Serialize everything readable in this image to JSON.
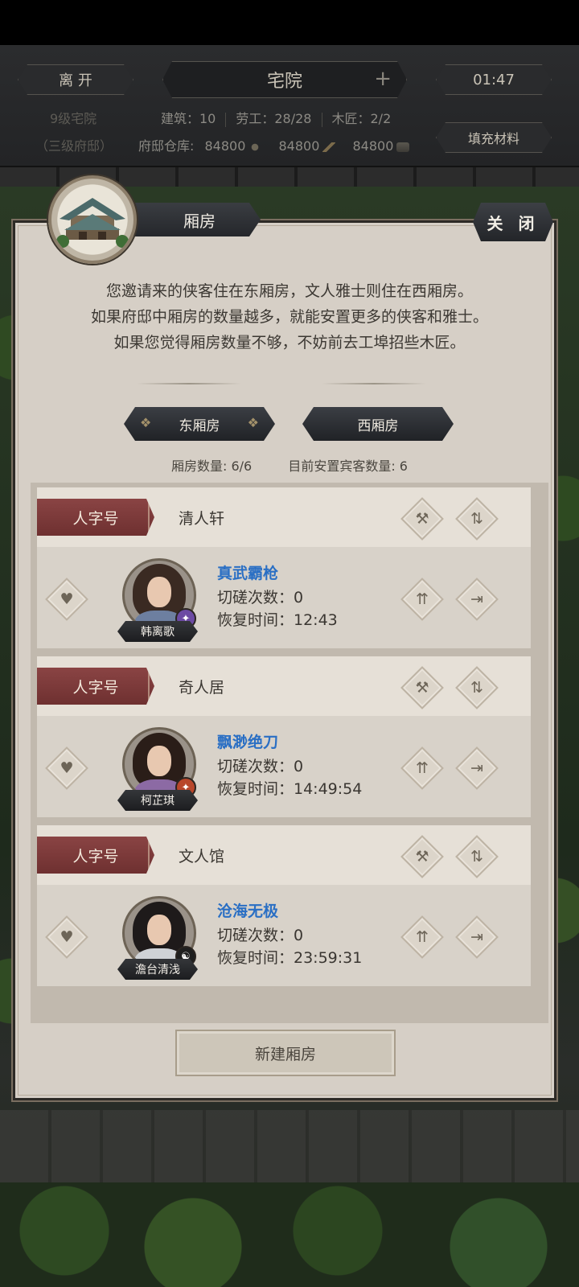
{
  "top": {
    "leave_label": "离 开",
    "title": "宅院",
    "timer": "01:47",
    "residence_level": "9级宅院",
    "residence_sub": "（三级府邸）",
    "building": "建筑：10",
    "labor": "劳工：28/28",
    "carpenter": "木匠：2/2",
    "warehouse_label": "府邸仓库:",
    "res1": "84800",
    "res2": "84800",
    "res3": "84800",
    "fill_label": "填充材料"
  },
  "panel": {
    "title": "厢房",
    "close_label": "关 闭",
    "intro": [
      "您邀请来的侠客住在东厢房，文人雅士则住在西厢房。",
      "如果府邸中厢房的数量越多，就能安置更多的侠客和雅士。",
      "如果您觉得厢房数量不够，不妨前去工埠招些木匠。"
    ],
    "tabs": [
      "东厢房",
      "西厢房"
    ],
    "room_count": "厢房数量: 6/6",
    "guest_count": "目前安置宾客数量: 6",
    "new_room_label": "新建厢房"
  },
  "rooms": [
    {
      "rank": "人字号",
      "name": "清人轩",
      "guest_name": "韩离歌",
      "school": "真武霸枪",
      "spar": "切磋次数：0",
      "recover": "恢复时间：12:43"
    },
    {
      "rank": "人字号",
      "name": "奇人居",
      "guest_name": "柯芷琪",
      "school": "飘渺绝刀",
      "spar": "切磋次数：0",
      "recover": "恢复时间：14:49:54"
    },
    {
      "rank": "人字号",
      "name": "文人馆",
      "guest_name": "澹台清浅",
      "school": "沧海无极",
      "spar": "切磋次数：0",
      "recover": "恢复时间：23:59:31"
    }
  ],
  "icons": {
    "build": "hammer-icon",
    "swap": "swap-icon",
    "favor": "heart-icon",
    "upgrade": "upgrade-icon",
    "evict": "exit-door-icon",
    "add": "plus-icon"
  },
  "colors": {
    "school_text": "#2a6fc4",
    "rank_red": "#7d3838"
  }
}
